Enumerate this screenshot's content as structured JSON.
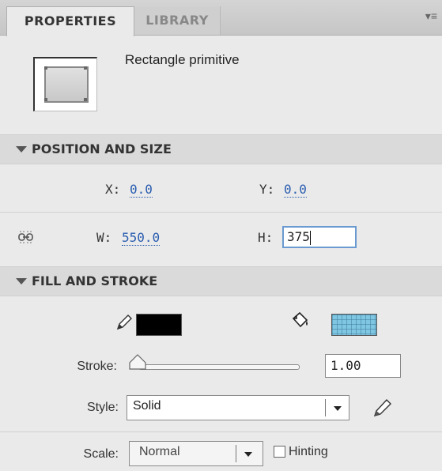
{
  "tabs": {
    "properties": "PROPERTIES",
    "library": "LIBRARY",
    "menu_icon": "panel-menu-icon"
  },
  "shape": {
    "title": "Rectangle primitive",
    "icon": "rectangle-primitive-icon"
  },
  "position_size": {
    "header": "POSITION AND SIZE",
    "x_label": "X:",
    "x_value": "0.0",
    "y_label": "Y:",
    "y_value": "0.0",
    "w_label": "W:",
    "w_value": "550.0",
    "h_label": "H:",
    "h_value": "375",
    "link_icon": "link-width-height-icon"
  },
  "fill_stroke": {
    "header": "FILL AND STROKE",
    "stroke_color": "#000000",
    "fill_color": "#7fc6e2",
    "stroke_label": "Stroke:",
    "stroke_value": "1.00",
    "style_label": "Style:",
    "style_value": "Solid",
    "scale_label": "Scale:",
    "scale_value": "Normal",
    "hinting_label": "Hinting",
    "hinting_checked": false
  }
}
